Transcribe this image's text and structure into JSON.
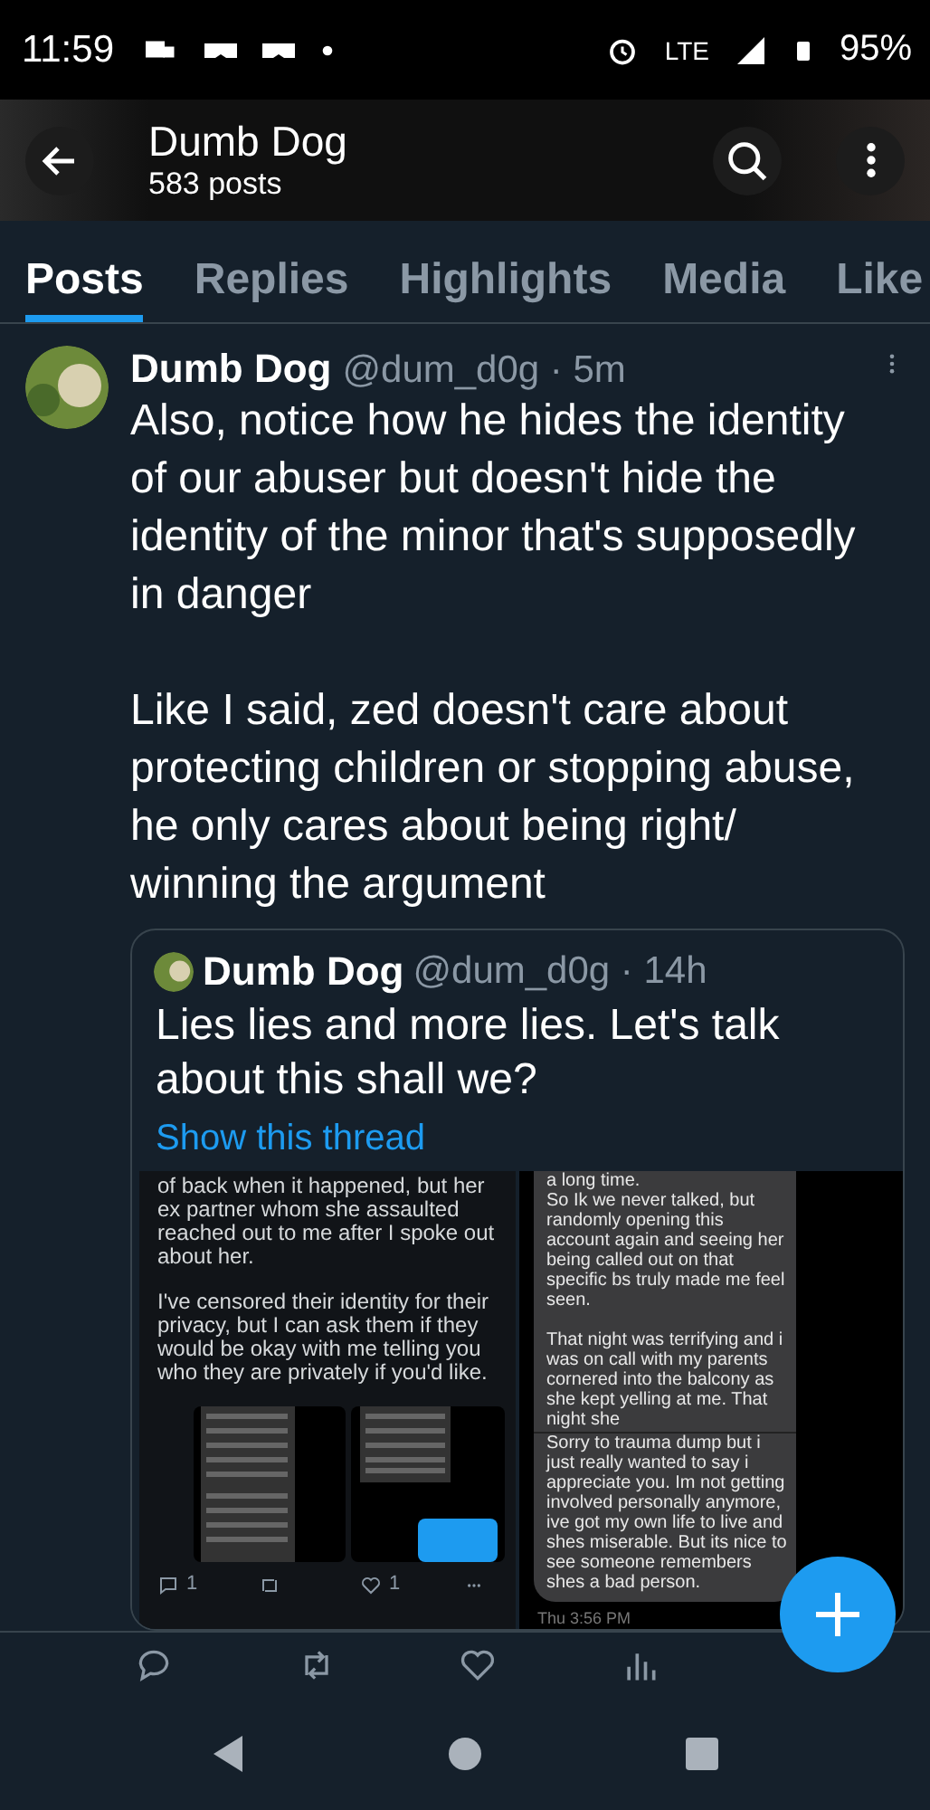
{
  "status_bar": {
    "time": "11:59",
    "network": "LTE",
    "battery": "95%"
  },
  "header": {
    "title": "Dumb Dog",
    "subtitle": "583 posts"
  },
  "tabs": [
    {
      "label": "Posts",
      "selected": true
    },
    {
      "label": "Replies",
      "selected": false
    },
    {
      "label": "Highlights",
      "selected": false
    },
    {
      "label": "Media",
      "selected": false
    },
    {
      "label": "Like",
      "selected": false
    }
  ],
  "post": {
    "author": "Dumb Dog",
    "meta": "@dum_d0g · 5m",
    "paragraphs": [
      "Also, notice how he hides the identity of our abuser but doesn't hide the identity of the minor that's supposedly in danger",
      "Like I said, zed doesn't care about protecting children or stopping abuse, he only cares about being right/ winning the argument"
    ],
    "quote": {
      "author": "Dumb Dog",
      "meta": "@dum_d0g · 14h",
      "text": "Lies lies and more lies. Let's talk about this shall we?",
      "link": "Show this thread",
      "left_screenshot": {
        "paragraphs": [
          "of back when it happened, but her ex partner whom she assaulted reached out to me after I spoke out about her.",
          "I've censored their identity for their privacy, but I can ask them if they would be okay with me telling you who they are privately if you'd like."
        ],
        "reply_count": "1",
        "like_count": "1"
      },
      "right_screenshot": {
        "bubbles": [
          {
            "paragraphs": [
              "a long time.\nSo Ik we never talked, but randomly opening this account again and seeing her being called out on that specific bs truly made me feel seen.",
              "That night was terrifying and i was on call with my parents cornered into the balcony as she kept yelling at me. That night she"
            ]
          },
          {
            "paragraphs": [
              "Sorry to trauma dump but i just really wanted to say i appreciate you. Im not getting involved personally anymore, ive got my own life to live and shes miserable. But its nice to see someone remembers shes a bad person."
            ]
          }
        ],
        "timestamp": "Thu 3:56 PM"
      }
    }
  }
}
